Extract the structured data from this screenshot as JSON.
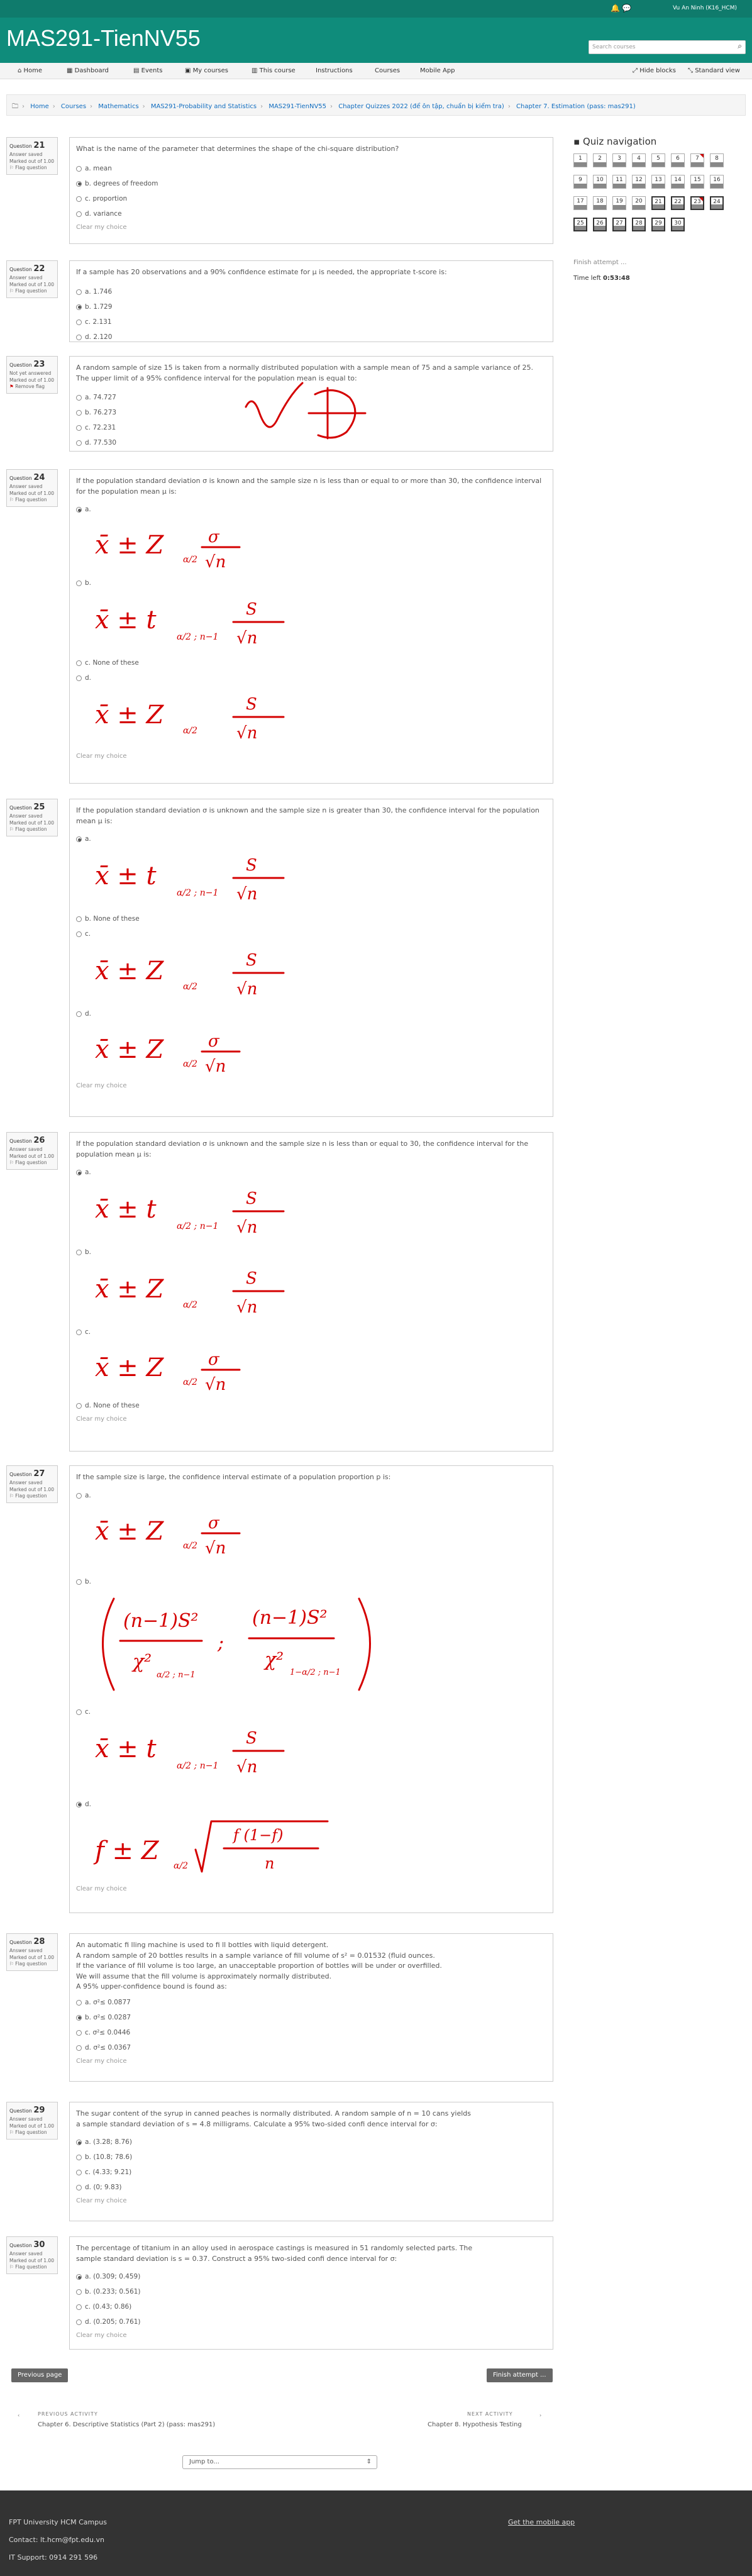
{
  "topbar": {
    "user": "Vu An Ninh (K16_HCM)"
  },
  "header": {
    "site_title": "MAS291-TienNV55",
    "search_placeholder": "Search courses"
  },
  "nav": {
    "home": "Home",
    "dashboard": "Dashboard",
    "events": "Events",
    "my_courses": "My courses",
    "this_course": "This course",
    "instructions": "Instructions",
    "courses": "Courses",
    "mobile_app": "Mobile App",
    "hide_blocks": "Hide blocks",
    "standard_view": "Standard view"
  },
  "breadcrumb": [
    "Home",
    "Courses",
    "Mathematics",
    "MAS291-Probability and Statistics",
    "MAS291-TienNV55",
    "Chapter Quizzes 2022 (để ôn tập, chuẩn bị kiểm tra)",
    "Chapter 7. Estimation (pass: mas291)"
  ],
  "labels": {
    "question": "Question",
    "answer_saved": "Answer saved",
    "not_answered": "Not yet answered",
    "marked": "Marked out of",
    "mark_value": "1.00",
    "flag": "Flag question",
    "remove_flag": "Remove flag",
    "clear": "Clear my choice"
  },
  "questions": [
    {
      "num": "21",
      "text": "What is the name of the parameter that determines the shape of the chi-square distribution?",
      "options": [
        "a. mean",
        "b. degrees of freedom",
        "c. proportion",
        "d. variance"
      ]
    },
    {
      "num": "22",
      "text": "If a sample has 20 observations and a 90% confidence estimate for μ is needed, the appropriate t-score is:",
      "options": [
        "a. 1.746",
        "b. 1.729",
        "c. 2.131",
        "d. 2.120"
      ]
    },
    {
      "num": "23",
      "text": "A random sample of size 15 is taken from a normally distributed population with a sample mean of 75 and a sample variance of 25. The upper limit of a 95% confidence interval for the population mean is equal to:",
      "options": [
        "a. 74.727",
        "b. 76.273",
        "c. 72.231",
        "d. 77.530"
      ]
    },
    {
      "num": "24",
      "text": "If the population standard deviation σ is known and the sample size n is less than or equal to or more than 30, the confidence interval for the population mean μ is:",
      "options": [
        "a.",
        "b.",
        "c. None of these",
        "d."
      ]
    },
    {
      "num": "25",
      "text": "If the population standard deviation σ is unknown and the sample size n is greater than 30, the confidence interval for the population mean μ is:",
      "options": [
        "a.",
        "b. None of these",
        "c.",
        "d."
      ]
    },
    {
      "num": "26",
      "text": "If the population standard deviation σ is unknown and the sample size n is less than or equal to 30, the confidence interval for the population mean μ is:",
      "options": [
        "a.",
        "b.",
        "c.",
        "d. None of these"
      ]
    },
    {
      "num": "27",
      "text": "If the sample size is large, the confidence interval estimate of a population proportion p is:",
      "options": [
        "a.",
        "b.",
        "c.",
        "d."
      ]
    },
    {
      "num": "28",
      "lines": [
        "An automatic fi lling machine is used to fi ll bottles with liquid detergent.",
        "A random sample of 20 bottles results in a sample variance of fill volume of s² = 0.01532 (fluid ounces.",
        "If the variance of fill volume is too large, an unacceptable proportion of bottles will be under or overfilled.",
        "We will assume that the fill volume is approximately normally distributed.",
        "A 95% upper-confidence bound is found as:"
      ],
      "options": [
        "a. σ²≤ 0.0877",
        "b. σ²≤ 0.0287",
        "c. σ²≤ 0.0446",
        "d. σ²≤ 0.0367"
      ]
    },
    {
      "num": "29",
      "lines": [
        "The sugar content of the syrup in canned peaches is normally distributed. A random sample of n = 10 cans yields",
        "a sample standard deviation of s = 4.8 milligrams. Calculate a 95% two-sided confi dence interval for σ:"
      ],
      "options": [
        "a. (3.28; 8.76)",
        "b. (10.8; 78.6)",
        "c. (4.33; 9.21)",
        "d. (0; 9.83)"
      ]
    },
    {
      "num": "30",
      "lines": [
        "The percentage of titanium in an alloy used in aerospace castings is measured in 51 randomly selected parts. The",
        "sample standard deviation is s = 0.37. Construct a 95% two-sided confi dence interval for σ:"
      ],
      "options": [
        "a. (0.309; 0.459)",
        "b. (0.233; 0.561)",
        "c. (0.43; 0.86)",
        "d. (0.205; 0.761)"
      ]
    }
  ],
  "quiz_nav": {
    "title": "Quiz navigation",
    "numbers": [
      "1",
      "2",
      "3",
      "4",
      "5",
      "6",
      "7",
      "8",
      "9",
      "10",
      "11",
      "12",
      "13",
      "14",
      "15",
      "16",
      "17",
      "18",
      "19",
      "20",
      "21",
      "22",
      "23",
      "24",
      "25",
      "26",
      "27",
      "28",
      "29",
      "30"
    ],
    "finish": "Finish attempt ...",
    "time_label": "Time left",
    "time": "0:53:48"
  },
  "buttons": {
    "prev": "Previous page",
    "finish": "Finish attempt ..."
  },
  "activity": {
    "prev_label": "PREVIOUS ACTIVITY",
    "prev_title": "Chapter 6. Descriptive Statistics (Part 2) (pass: mas291)",
    "next_label": "NEXT ACTIVITY",
    "next_title": "Chapter 8. Hypothesis Testing",
    "jump": "Jump to..."
  },
  "footer": {
    "campus": "FPT University HCM Campus",
    "contact": "Contact: lt.hcm@fpt.edu.vn",
    "support": "IT Support: 0914 291 596",
    "mobile": "Get the mobile app"
  }
}
